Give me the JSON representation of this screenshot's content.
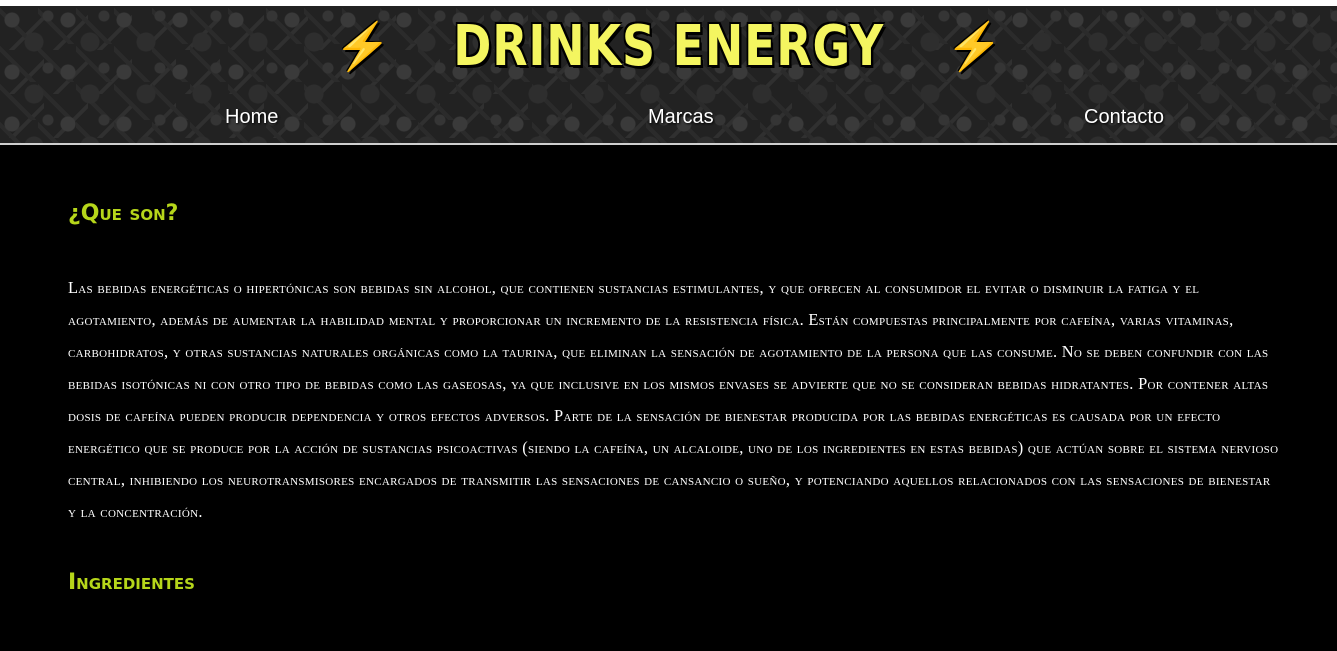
{
  "header": {
    "title": "DRINKS ENERGY",
    "bolt_glyph": "⚡",
    "background_color": "#222222",
    "title_color": "#f4f560"
  },
  "nav": {
    "items": [
      {
        "label": "Home"
      },
      {
        "label": "Marcas"
      },
      {
        "label": "Contacto"
      }
    ]
  },
  "main": {
    "sections": [
      {
        "heading": "¿Que son?",
        "paragraph": "Las bebidas energéticas o hipertónicas son bebidas sin alcohol, que contienen sustancias estimulantes, y que ofrecen al consumidor el evitar o disminuir la fatiga y el agotamiento, además de aumentar la habilidad mental y proporcionar un incremento de la resistencia física. Están compuestas principalmente por cafeína, varias vitaminas, carbohidratos, y otras sustancias naturales orgánicas como la taurina, que eliminan la sensación de agotamiento de la persona que las consume. No se deben confundir con las bebidas isotónicas ni con otro tipo de bebidas como las gaseosas, ya que inclusive en los mismos envases se advierte que no se consideran bebidas hidratantes. Por contener altas dosis de cafeína pueden producir dependencia y otros efectos adversos. Parte de la sensación de bienestar producida por las bebidas energéticas es causada por un efecto energético que se produce por la acción de sustancias psicoactivas (siendo la cafeína, un alcaloide, uno de los ingredientes en estas bebidas) que actúan sobre el sistema nervioso central, inhibiendo los neurotransmisores encargados de transmitir las sensaciones de cansancio o sueño, y potenciando aquellos relacionados con las sensaciones de bienestar y la concentración."
      },
      {
        "heading": "Ingredientes"
      }
    ],
    "heading_color": "#b6d61a",
    "text_color": "#ffffff"
  }
}
